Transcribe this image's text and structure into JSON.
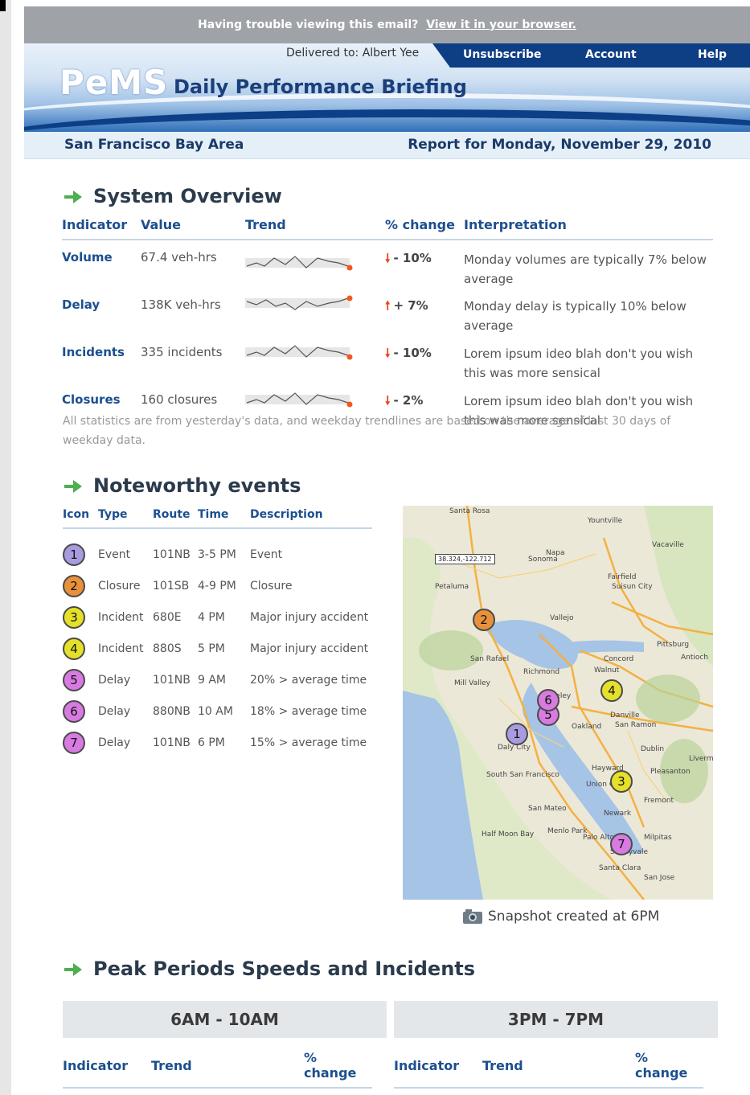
{
  "topbar": {
    "text": "Having trouble viewing this email?",
    "link": "View it in your browser."
  },
  "header": {
    "delivered_label": "Delivered to:",
    "delivered_name": "Albert Yee",
    "nav": [
      "Unsubscribe",
      "Account",
      "Help"
    ],
    "logo": "PeMS",
    "subtitle": "Daily Performance Briefing"
  },
  "location": {
    "region": "San Francisco Bay Area",
    "report_date": "Report for Monday, November 29, 2010"
  },
  "overview": {
    "title": "System Overview",
    "columns": [
      "Indicator",
      "Value",
      "Trend",
      "% change",
      "Interpretation"
    ],
    "rows": [
      {
        "indicator": "Volume",
        "value": "67.4 veh-hrs",
        "direction": "down",
        "change": "- 10%",
        "interpretation": "Monday volumes are typically 7% below average"
      },
      {
        "indicator": "Delay",
        "value": "138K veh-hrs",
        "direction": "up",
        "change": "+ 7%",
        "interpretation": "Monday delay is typically 10% below average"
      },
      {
        "indicator": "Incidents",
        "value": "335 incidents",
        "direction": "down",
        "change": "- 10%",
        "interpretation": "Lorem ipsum ideo blah don't you wish this was more sensical"
      },
      {
        "indicator": "Closures",
        "value": "160 closures",
        "direction": "down",
        "change": "- 2%",
        "interpretation": "Lorem ipsum ideo blah don't you wish this was more sensical"
      }
    ],
    "note": "All statistics are from yesterday's data, and weekday trendlines are based on the average of last 30 days of weekday data."
  },
  "events": {
    "title": "Noteworthy events",
    "columns": [
      "Icon",
      "Type",
      "Route",
      "Time",
      "Description"
    ],
    "rows": [
      {
        "num": "1",
        "color": "#a99be0",
        "type": "Event",
        "route": "101NB",
        "time": "3-5 PM",
        "desc": "Event"
      },
      {
        "num": "2",
        "color": "#e8913a",
        "type": "Closure",
        "route": "101SB",
        "time": "4-9 PM",
        "desc": "Closure"
      },
      {
        "num": "3",
        "color": "#e5e02a",
        "type": "Incident",
        "route": "680E",
        "time": "4 PM",
        "desc": "Major injury accident"
      },
      {
        "num": "4",
        "color": "#e5e02a",
        "type": "Incident",
        "route": "880S",
        "time": "5 PM",
        "desc": "Major injury accident"
      },
      {
        "num": "5",
        "color": "#d77be0",
        "type": "Delay",
        "route": "101NB",
        "time": "9 AM",
        "desc": "20% > average time"
      },
      {
        "num": "6",
        "color": "#d77be0",
        "type": "Delay",
        "route": "880NB",
        "time": "10 AM",
        "desc": "18% > average time"
      },
      {
        "num": "7",
        "color": "#d77be0",
        "type": "Delay",
        "route": "101NB",
        "time": "6 PM",
        "desc": "15% > average time"
      }
    ]
  },
  "map": {
    "coordinate": "38.324,-122.712",
    "places": [
      "Santa Rosa",
      "Napa",
      "Petaluma",
      "Vallejo",
      "Fairfield",
      "Suisun City",
      "Concord",
      "Walnut",
      "San Rafael",
      "Richmond",
      "Berkeley",
      "Oakland",
      "San Ramon",
      "Danville",
      "Dublin",
      "Pleasanton",
      "Livermore",
      "Hayward",
      "Union City",
      "Fremont",
      "San Mateo",
      "Newark",
      "Palo Alto",
      "Milpitas",
      "Sunnyvale",
      "Santa Clara",
      "San Jose",
      "Daly City",
      "South San Francisco",
      "Antioch",
      "Pittsburg",
      "Sonoma",
      "Yountville",
      "Vacaville",
      "Half Moon Bay",
      "Menlo Park",
      "Mill Valley"
    ],
    "snapshot": "Snapshot created at 6PM"
  },
  "peak": {
    "title": "Peak Periods Speeds and Incidents",
    "periods": [
      "6AM - 10AM",
      "3PM - 7PM"
    ],
    "columns": [
      "Indicator",
      "Trend",
      "% change"
    ]
  }
}
